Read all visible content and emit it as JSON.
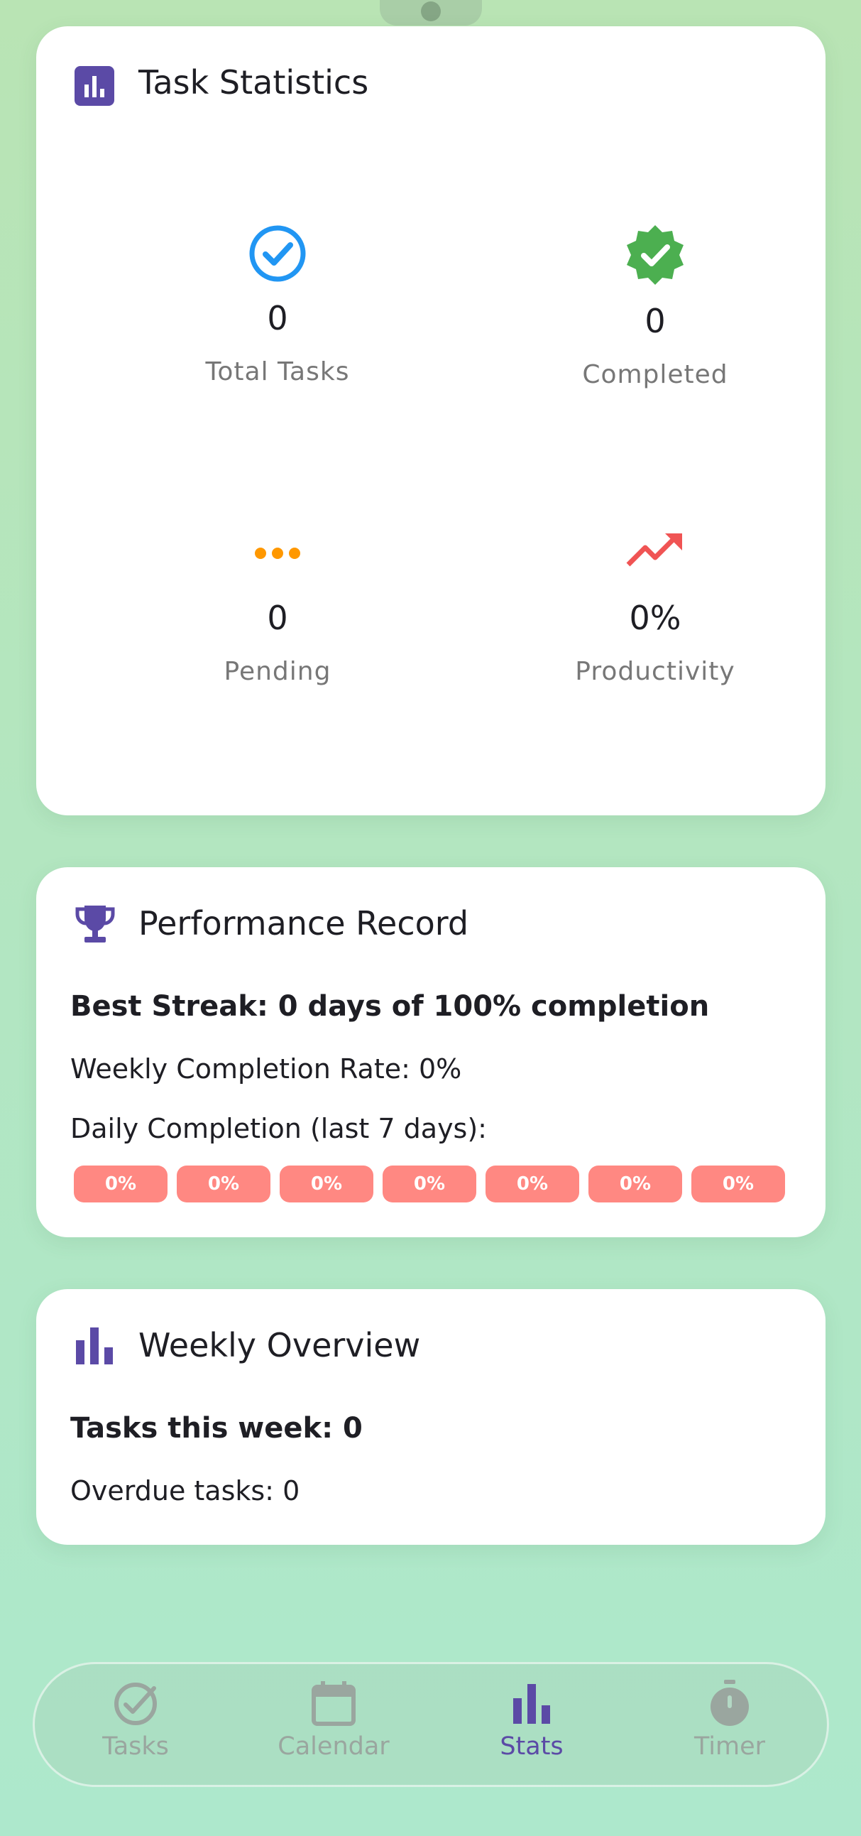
{
  "stats_card": {
    "title": "Task Statistics",
    "items": [
      {
        "icon": "check-circle-icon",
        "value": "0",
        "label": "Total Tasks",
        "color": "#2196f3"
      },
      {
        "icon": "verified-badge-icon",
        "value": "0",
        "label": "Completed",
        "color": "#4caf50"
      },
      {
        "icon": "more-horiz-icon",
        "value": "0",
        "label": "Pending",
        "color": "#ff9800"
      },
      {
        "icon": "trending-up-icon",
        "value": "0%",
        "label": "Productivity",
        "color": "#f05454"
      }
    ]
  },
  "performance_card": {
    "title": "Performance Record",
    "best_streak": "Best Streak: 0 days of 100% completion",
    "weekly_rate": "Weekly Completion Rate: 0%",
    "daily_label": "Daily Completion (last 7 days):",
    "daily": [
      "0%",
      "0%",
      "0%",
      "0%",
      "0%",
      "0%",
      "0%"
    ]
  },
  "weekly_card": {
    "title": "Weekly Overview",
    "tasks_this_week": "Tasks this week: 0",
    "overdue": "Overdue tasks: 0"
  },
  "nav": {
    "items": [
      {
        "label": "Tasks",
        "icon": "check-circle-icon",
        "active": false
      },
      {
        "label": "Calendar",
        "icon": "calendar-icon",
        "active": false
      },
      {
        "label": "Stats",
        "icon": "bar-chart-icon",
        "active": true
      },
      {
        "label": "Timer",
        "icon": "timer-icon",
        "active": false
      }
    ]
  },
  "colors": {
    "accent": "#5b4aa6",
    "pill": "#ff8882",
    "background_top": "#b9e4b4",
    "background_bottom": "#ade8cc"
  }
}
